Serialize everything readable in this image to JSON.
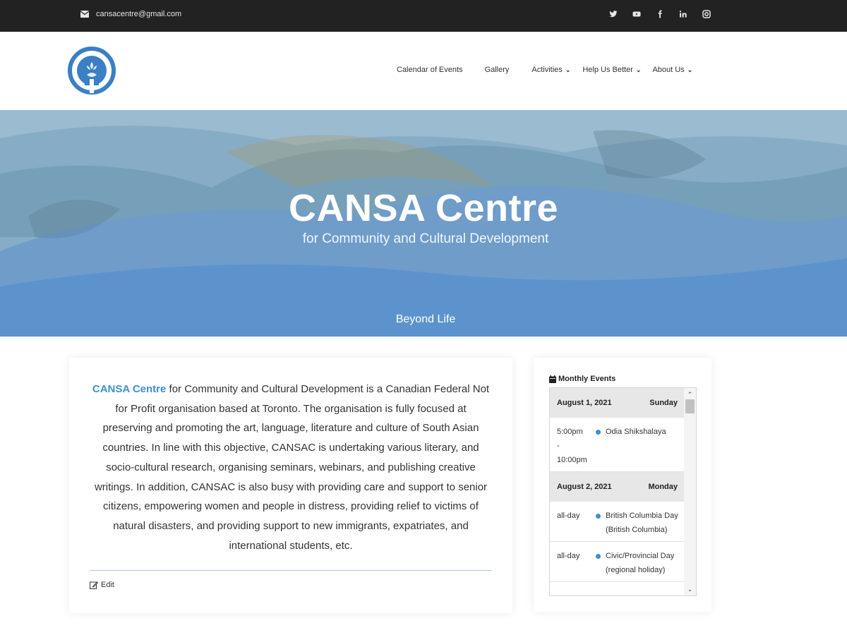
{
  "topbar": {
    "email": "cansacentre@gmail.com",
    "socials": [
      "twitter-icon",
      "youtube-icon",
      "facebook-icon",
      "linkedin-icon",
      "instagram-icon"
    ]
  },
  "nav": {
    "items": [
      {
        "label": "Calendar of Events",
        "dropdown": false
      },
      {
        "label": "Gallery",
        "dropdown": false
      },
      {
        "label": "Activities",
        "dropdown": true
      },
      {
        "label": "Help Us Better",
        "dropdown": true
      },
      {
        "label": "About Us",
        "dropdown": true
      }
    ]
  },
  "hero": {
    "title": "CANSA Centre",
    "subtitle": "for Community and Cultural Development",
    "tagline": "Beyond Life"
  },
  "content": {
    "link_text": "CANSA Centre",
    "body": " for Community and Cultural Development is a Canadian Federal Not for Profit organisation based at Toronto. The organisation is fully focused at preserving and promoting the art, language, literature and culture of South Asian countries. In line with this objective, CANSAC is undertaking various literary, and socio-cultural research, organising seminars, webinars, and publishing creative writings. In addition, CANSAC is also busy with providing care and support to senior citizens, empowering women and people in distress, providing relief to victims of natural disasters, and providing support to new immigrants, expatriates, and international students, etc.",
    "edit_label": "Edit"
  },
  "widget": {
    "title": "Monthly Events",
    "days": [
      {
        "date": "August 1, 2021",
        "weekday": "Sunday",
        "events": [
          {
            "time_lines": [
              "5:00pm",
              "-",
              "10:00pm"
            ],
            "name": "Odia Shikshalaya"
          }
        ]
      },
      {
        "date": "August 2, 2021",
        "weekday": "Monday",
        "events": [
          {
            "time_lines": [
              "all-day"
            ],
            "name": "British Columbia Day (British Columbia)"
          },
          {
            "time_lines": [
              "all-day"
            ],
            "name": "Civic/Provincial Day (regional holiday)"
          }
        ]
      }
    ]
  },
  "colors": {
    "topbar": "#222222",
    "accent": "#3d8fd1",
    "logo_blue": "#3b7fc4"
  }
}
